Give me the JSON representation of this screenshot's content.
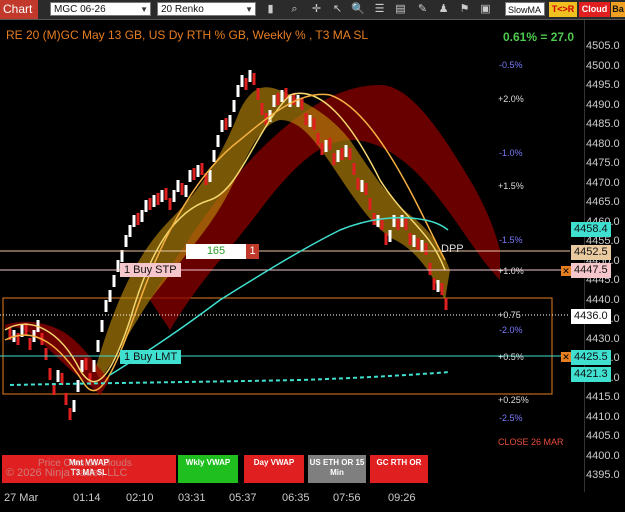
{
  "toolbar": {
    "chart_tab": "Chart",
    "instrument": "MGC 06-26",
    "bar_type": "20 Renko",
    "ma_select": "SlowMA",
    "tick_btn": "T<>R",
    "cloud_btn": "Cloud",
    "bar_btn": "Ba"
  },
  "chart": {
    "title": "RE 20  (M)GC May 13 GB, US Dy RTH % GB, Weekly % , T3 MA SL",
    "pct_change": "0.61% = 27.0",
    "dpp_label": "DPP",
    "close_label": "CLOSE 26 MAR",
    "watermark": "© 2026 NinjaTrader, LLC",
    "watermark2": "Price Outside Clouds"
  },
  "y_ticks": [
    "4505.0",
    "4500.0",
    "4495.0",
    "4490.0",
    "4485.0",
    "4480.0",
    "4475.0",
    "4470.0",
    "4465.0",
    "4460.0",
    "4455.0",
    "4450.0",
    "4445.0",
    "4440.0",
    "4435.0",
    "4430.0",
    "4425.0",
    "4420.0",
    "4415.0",
    "4410.0",
    "4405.0",
    "4400.0",
    "4395.0"
  ],
  "x_ticks": [
    "27 Mar",
    "01:14",
    "02:10",
    "03:31",
    "05:37",
    "06:35",
    "07:56",
    "09:26"
  ],
  "pct_levels": [
    {
      "text": "-0.5%",
      "color": "#7b7bff"
    },
    {
      "text": "+2.0%",
      "color": "#dddddd"
    },
    {
      "text": "-1.0%",
      "color": "#7b7bff"
    },
    {
      "text": "+1.5%",
      "color": "#dddddd"
    },
    {
      "text": "-1.5%",
      "color": "#7b7bff"
    },
    {
      "text": "+1.0%",
      "color": "#dddddd"
    },
    {
      "text": "+0.75",
      "color": "#dddddd"
    },
    {
      "text": "-2.0%",
      "color": "#7b7bff"
    },
    {
      "text": "+0.5%",
      "color": "#dddddd"
    },
    {
      "text": "+0.25%",
      "color": "#dddddd"
    },
    {
      "text": "-2.5%",
      "color": "#7b7bff"
    }
  ],
  "price_markers": [
    {
      "text": "4458.4",
      "bg": "#40e0d0"
    },
    {
      "text": "4452.5",
      "bg": "#e8c9a0"
    },
    {
      "text": "4447.5",
      "bg": "#f5c6cb"
    },
    {
      "text": "4436.0",
      "bg": "#ffffff"
    },
    {
      "text": "4425.5",
      "bg": "#40e0d0"
    },
    {
      "text": "4421.3",
      "bg": "#40e0d0"
    }
  ],
  "orders": {
    "stop": "1 Buy STP",
    "limit": "1 Buy LMT",
    "qty_flag": "165",
    "qty_count": "1"
  },
  "bottom_buttons": [
    {
      "label": "Mnt VWAP\nT3 MA SL",
      "bg": "#e02020"
    },
    {
      "label": "Wkly VWAP",
      "bg": "#1fbf1f"
    },
    {
      "label": "Day VWAP",
      "bg": "#e02020"
    },
    {
      "label": "US ETH OR 15 Min",
      "bg": "#7f7f7f"
    },
    {
      "label": "GC RTH OR",
      "bg": "#e02020"
    }
  ],
  "colors": {
    "up_bar": "#ffffff",
    "down_bar": "#e02020",
    "cloud_orange": "#b8860b",
    "cloud_red": "#8b0000",
    "ma_yellow": "#f5d76e",
    "ma_orange": "#f5b041",
    "vwap_cyan": "#40e0d0"
  }
}
